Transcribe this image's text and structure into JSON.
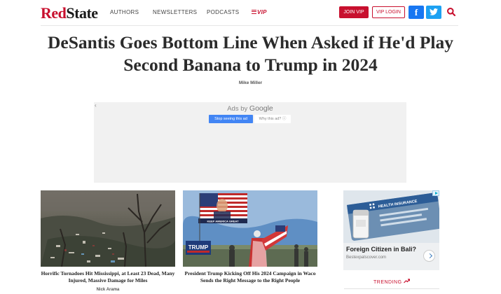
{
  "site": {
    "logo_part1": "Red",
    "logo_part2": "State",
    "brand_color": "#c8102e"
  },
  "nav": {
    "items": [
      "AUTHORS",
      "NEWSLETTERS",
      "PODCASTS"
    ],
    "vip_label": "VIP",
    "join_label": "JOIN VIP",
    "login_label": "VIP LOGIN",
    "facebook_icon": "facebook-icon",
    "twitter_icon": "twitter-icon",
    "search_icon": "search-icon"
  },
  "article": {
    "title": "DeSantis Goes Bottom Line When Asked if He'd Play Second Banana to Trump in 2024",
    "author": "Mike Miller"
  },
  "ad": {
    "prefix": "Ads by ",
    "brand": "Google",
    "stop_label": "Stop seeing this ad",
    "why_label": "Why this ad?",
    "why_icon": "info-icon",
    "back_icon": "back-arrow-icon"
  },
  "cards": [
    {
      "title": "Horrific Tornadoes Hit Mississippi, at Least 23 Dead, Many Injured, Massive Damage for Miles",
      "author": "Nick Arama"
    },
    {
      "title": "President Trump Kicking Off His 2024 Campaign in Waco Sends the Right Message to the Right People",
      "author": "",
      "sign_text": "TRUMP",
      "banner_text": "KEEP AMERICA GREAT"
    }
  ],
  "side_ad": {
    "image_caption": "HEALTH INSURANCE",
    "title": "Foreign Citizen in Bali?",
    "source": "Bestexpatscover.com",
    "badge_icon": "adchoices-icon",
    "arrow_icon": "chevron-right-icon"
  },
  "trending": {
    "label": "TRENDING",
    "icon": "trending-up-icon"
  }
}
